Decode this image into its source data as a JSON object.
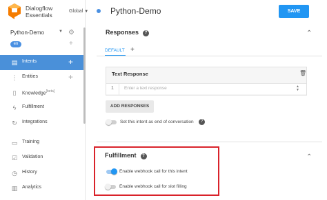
{
  "sidebar": {
    "brand": "Dialogflow Essentials",
    "region": "Global",
    "agent": "Python-Demo",
    "language": "en",
    "items": [
      {
        "label": "Intents",
        "icon": "intents-icon",
        "active": true,
        "plus": "+"
      },
      {
        "label": "Entities",
        "icon": "entities-icon",
        "active": false,
        "plus": "+"
      },
      {
        "label": "Knowledge",
        "badge": "[beta]",
        "icon": "knowledge-icon",
        "active": false
      },
      {
        "label": "Fulfillment",
        "icon": "lightning-icon",
        "active": false
      },
      {
        "label": "Integrations",
        "icon": "integrations-icon",
        "active": false
      },
      {
        "label": "Training",
        "icon": "training-icon",
        "active": false
      },
      {
        "label": "Validation",
        "icon": "validation-icon",
        "active": false
      },
      {
        "label": "History",
        "icon": "history-icon",
        "active": false
      },
      {
        "label": "Analytics",
        "icon": "analytics-icon",
        "active": false
      }
    ]
  },
  "header": {
    "intent_name": "Python-Demo",
    "save_label": "SAVE"
  },
  "responses": {
    "title": "Responses",
    "tab": "DEFAULT",
    "card_title": "Text Response",
    "row_number": "1",
    "placeholder": "Enter a text response",
    "add_button": "ADD RESPONSES",
    "end_conversation_label": "Set this intent as end of conversation",
    "end_conversation_on": false
  },
  "fulfillment": {
    "title": "Fulfillment",
    "webhook_label": "Enable webhook call for this intent",
    "webhook_on": true,
    "slot_filling_label": "Enable webhook call for slot filling",
    "slot_filling_on": false
  },
  "colors": {
    "accent": "#2196f3",
    "active_nav": "#4a90d9",
    "highlight": "#d9222a"
  }
}
